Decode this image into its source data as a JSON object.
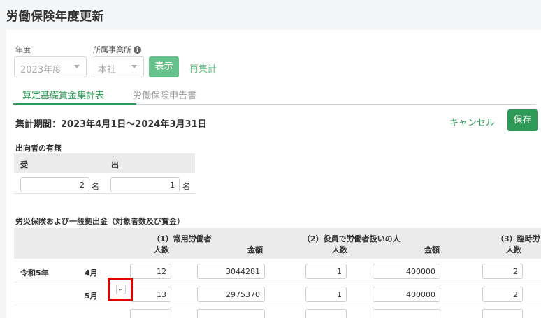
{
  "page": {
    "title": "労働保険年度更新"
  },
  "filters": {
    "year_label": "年度",
    "year_value": "2023年度",
    "office_label": "所属事業所",
    "office_info_icon": "info-icon",
    "office_value": "本社",
    "show_button": "表示",
    "recalc_link": "再集計"
  },
  "tabs": [
    {
      "label": "算定基礎賃金集計表",
      "active": true
    },
    {
      "label": "労働保険申告書",
      "active": false
    }
  ],
  "period": "集計期間：2023年4月1日〜2024年3月31日",
  "actions": {
    "cancel": "キャンセル",
    "save": "保存"
  },
  "secondment": {
    "title": "出向者の有無",
    "col_receive": "受",
    "col_send": "出",
    "receive_value": "2",
    "send_value": "1",
    "unit": "名"
  },
  "insurance": {
    "title": "労災保険および一般拠出金（対象者数及び賃金）",
    "groups": [
      {
        "label": "（1）常用労働者",
        "count_header": "人数",
        "amount_header": "金額"
      },
      {
        "label": "（2）役員で労働者扱いの人",
        "count_header": "人数",
        "amount_header": "金額"
      },
      {
        "label": "（3）臨時労",
        "count_header": "人数"
      }
    ],
    "era_label": "令和5年",
    "rows": [
      {
        "month": "4月",
        "regular_count": "12",
        "regular_amount": "3044281",
        "officer_count": "1",
        "officer_amount": "400000",
        "temp_count": "2"
      },
      {
        "month": "5月",
        "regular_count": "13",
        "regular_amount": "2975370",
        "officer_count": "1",
        "officer_amount": "400000",
        "temp_count": "2"
      }
    ],
    "enter_key_icon": "↵",
    "colors": {
      "accent": "#2e9a57",
      "highlight": "#e00000"
    }
  }
}
